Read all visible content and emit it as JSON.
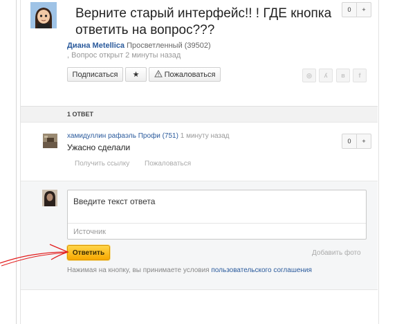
{
  "question": {
    "title": "Верните старый интерфейс!! ! ГДЕ кнопка ответить на вопрос???",
    "vote_count": "0",
    "vote_plus": "+",
    "author_name": "Диана Metellica",
    "author_rank": "Просветленный (39502)",
    "meta": ", Вопрос открыт 2 минуты назад",
    "subscribe_label": "Подписаться",
    "star_label": "★",
    "report_label": "Пожаловаться",
    "share_icons": [
      "mailru-icon",
      "odnoklassniki-icon",
      "vkontakte-icon",
      "facebook-icon"
    ],
    "share_glyphs": [
      "◎",
      "ʎ",
      "в",
      "f"
    ]
  },
  "answers": {
    "count_label": "1 ОТВЕТ",
    "items": [
      {
        "author_name": "хамидуллин рафаэль",
        "author_rank": "Профи (751)",
        "time": "1 минуту назад",
        "text": "Ужасно сделали",
        "vote_count": "0",
        "vote_plus": "+",
        "get_link_label": "Получить ссылку",
        "report_label": "Пожаловаться"
      }
    ]
  },
  "reply_form": {
    "placeholder": "Введите текст ответа",
    "source_placeholder": "Источник",
    "submit_label": "Ответить",
    "add_photo_label": "Добавить фото",
    "terms_text": "Нажимая на кнопку, вы принимаете условия",
    "terms_link": "пользовательского соглашения"
  },
  "colors": {
    "link": "#2a5a9c",
    "accent_orange": "#f7a800",
    "annotation_red": "#e21b1b"
  }
}
